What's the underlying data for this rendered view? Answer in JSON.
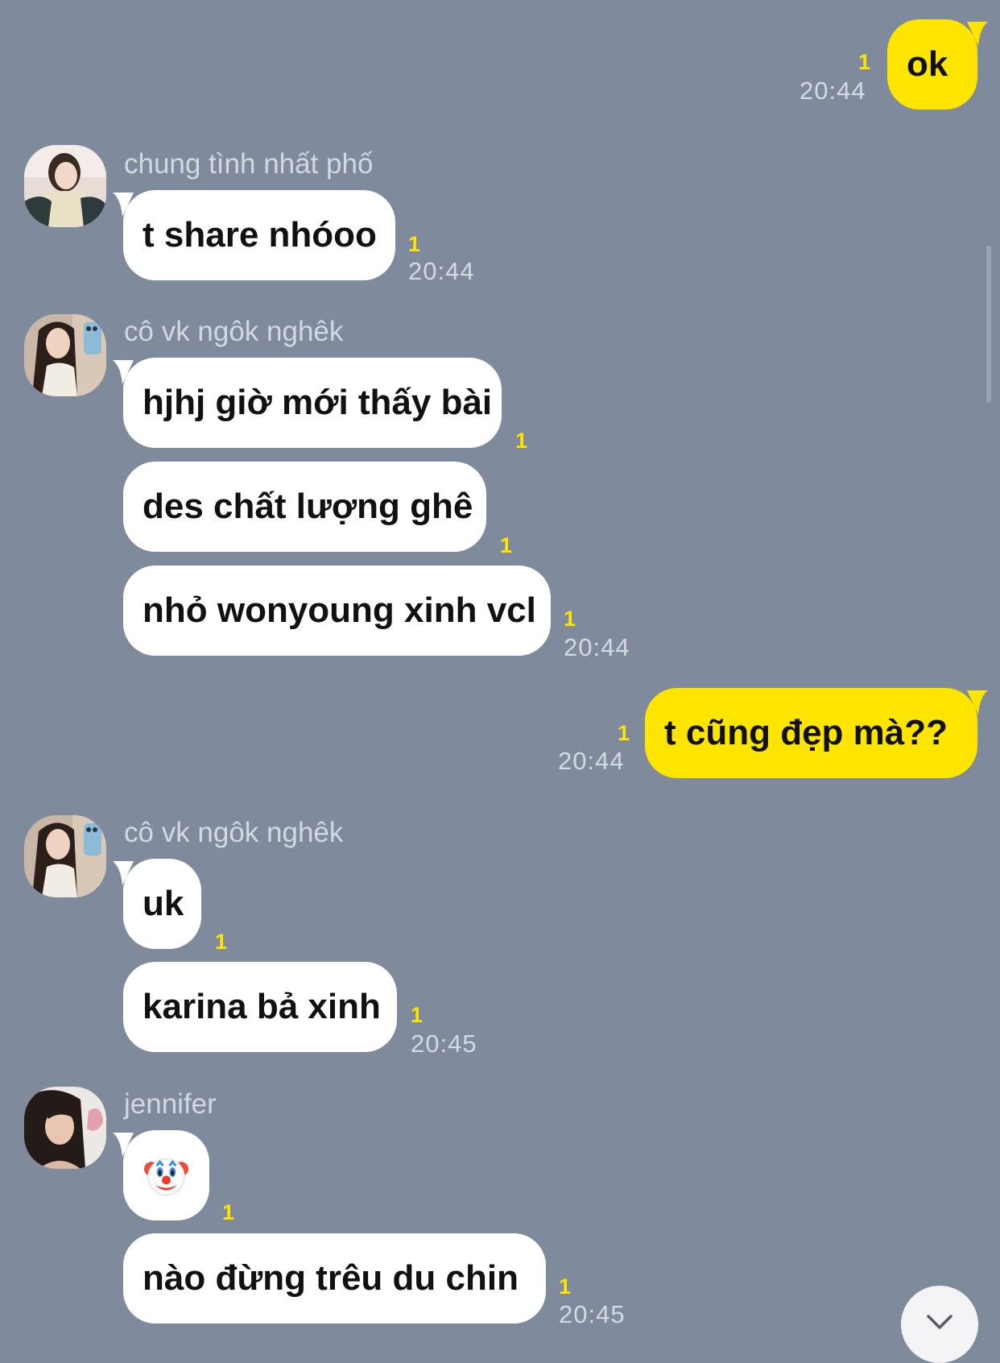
{
  "messages": {
    "m1_text": "ok",
    "m1_unread": "1",
    "m1_time": "20:44",
    "g1_sender": "chung tình nhất phố",
    "m2_text": "t share nhóoo",
    "m2_unread": "1",
    "m2_time": "20:44",
    "g2_sender": "cô vk ngôk nghêk",
    "m3_text": "hjhj giờ mới thấy bài",
    "m3_unread": "1",
    "m4_text": "des chất lượng ghê",
    "m4_unread": "1",
    "m5_text": "nhỏ wonyoung xinh vcl",
    "m5_unread": "1",
    "m5_time": "20:44",
    "m6_text": "t cũng đẹp mà??",
    "m6_unread": "1",
    "m6_time": "20:44",
    "g3_sender": "cô vk ngôk nghêk",
    "m7_text": "uk",
    "m7_unread": "1",
    "m8_text": "karina bả xinh",
    "m8_unread": "1",
    "m8_time": "20:45",
    "g4_sender": "jennifer",
    "m9_text": "🤡",
    "m9_unread": "1",
    "m10_text": "nào đừng trêu du chin",
    "m10_unread": "1",
    "m10_time": "20:45"
  },
  "colors": {
    "background": "#7f8a9c",
    "outgoing_bubble": "#fee500",
    "incoming_bubble": "#ffffff",
    "unread_count": "#fee500"
  },
  "icons": {
    "scroll_down": "chevron-down-icon"
  }
}
